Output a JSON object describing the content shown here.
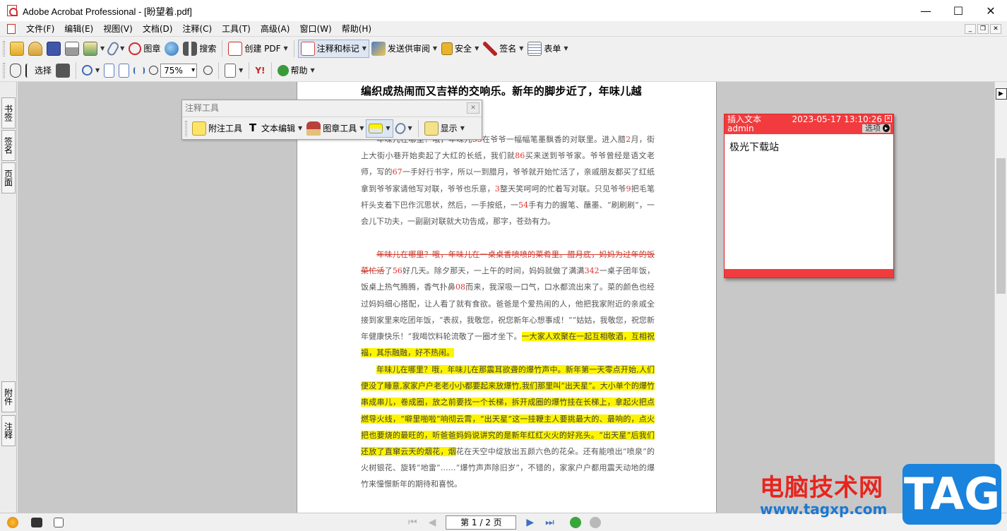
{
  "window": {
    "title": "Adobe Acrobat Professional - [盼望着.pdf]",
    "minimize": "—",
    "maximize": "☐",
    "close": "✕"
  },
  "menu": [
    "文件(F)",
    "编辑(E)",
    "视图(V)",
    "文档(D)",
    "注释(C)",
    "工具(T)",
    "高级(A)",
    "窗口(W)",
    "帮助(H)"
  ],
  "toolbar1": {
    "stamp": "图章",
    "search": "搜索",
    "create_pdf": "创建 PDF",
    "comment_markup": "注释和标记",
    "send_review": "发送供审阅",
    "security": "安全",
    "sign": "签名",
    "forms": "表单"
  },
  "toolbar2": {
    "select": "选择",
    "zoom_value": "75%",
    "help": "帮助"
  },
  "leftnav": {
    "bookmarks": "书签",
    "signatures": "签名",
    "pages": "页面",
    "attachments": "附件",
    "comments": "注释"
  },
  "annotation_toolbar": {
    "title": "注释工具",
    "note_tool": "附注工具",
    "text_edit": "文本编辑",
    "stamp_tool": "图章工具",
    "show": "显示"
  },
  "document": {
    "heading": "编织成热闹而又吉祥的交响乐。新年的脚步近了，年味儿越",
    "para1": [
      {
        "t": "年味儿在哪里？哦，年味儿"
      },
      {
        "t": "55",
        "n": true
      },
      {
        "t": "在爷爷一幅幅笔墨飘香的对联里。进入腊"
      },
      {
        "t": "2",
        "n": true
      },
      {
        "t": "月，街上大街小巷开始卖起了大红的长纸，我们就"
      },
      {
        "t": "86",
        "n": true
      },
      {
        "t": "买来送到爷爷家。爷爷曾经是语文老师，写的"
      },
      {
        "t": "67",
        "n": true
      },
      {
        "t": "一手好行书字，所以一到腊月，爷爷就开始忙活了，亲戚朋友都买了红纸拿到爷爷家请他写对联，爷爷也乐意，"
      },
      {
        "t": "3",
        "n": true
      },
      {
        "t": "整天笑呵呵的忙着写对联。只见爷爷"
      },
      {
        "t": "9",
        "n": true
      },
      {
        "t": "把毛笔杆头支着下巴作沉思状，然后，一手按纸，一"
      },
      {
        "t": "54",
        "n": true
      },
      {
        "t": "手有力的握笔、蘸墨、“刷刷刷”，一会儿下功夫，一副副对联就大功告成，那字，苍劲有力。"
      }
    ],
    "para2_strike": "年味儿在哪里？哦，年味儿在一桌桌香喷喷的菜肴里。腊月底，妈妈为过年的饭菜忙活",
    "para2_a": "了",
    "para2_n1": "56",
    "para2_b": "好几天。除夕那天，一上午的时间，妈妈就做了满满",
    "para2_n2": "342",
    "para2_c": "一桌子团年饭，饭桌上热气腾腾，香气扑鼻",
    "para2_n3": "08",
    "para2_d": "而来，我深吸一口气，口水都流出来了。菜的颜色也经过妈妈细心搭配，让人看了就有食欲。爸爸是个爱热闹的人，他把我家附近的亲戚全接到家里来吃团年饭，“表叔，我敬您，祝您新年心想事成！”“姑姑，我敬您，祝您新年健康快乐！”我喝饮料轮流敬了一圈才坐下。",
    "para2_hl": "一大家人欢聚在一起互相敬酒，互相祝福，其乐融融，好不热闹。",
    "para3_hl": "年味儿在哪里？哦，年味儿在那震耳欲聋的爆竹声中。新年第一天零点开始,人们便没了睡意,家家户户老老小小都要起来放爆竹,我们那里叫“出天星”。大小单个的爆竹串成串儿，卷成圈，放之前要找一个长梯，拆开成圈的爆竹挂在长梯上，拿起火把点燃导火线，“噼里啪啦”响彻云霄，“出天星”这一挂鞭主人要挑最大的、最响的，点火把也要烧的最旺的，听爸爸妈妈说讲究的是新年红红火火的好兆头。“出天星”后我们还放了直窜云天的烟花，烟",
    "para3_rest": "花在天空中绽放出五颜六色的花朵。还有能喷出“喷泉”的火树银花、旋转“地雷”……“爆竹声声除旧岁”，不错的，家家户户都用震天动地的爆竹来憧憬新年的期待和喜悦。"
  },
  "note": {
    "label": "插入文本",
    "author": "admin",
    "timestamp": "2023-05-17 13:10:26",
    "options": "选项",
    "content": "极光下载站"
  },
  "status": {
    "page_indicator": "第 1 / 2 页"
  },
  "watermark": {
    "site_name": "电脑技术网",
    "url": "www.tagxp.com",
    "tag": "TAG"
  }
}
